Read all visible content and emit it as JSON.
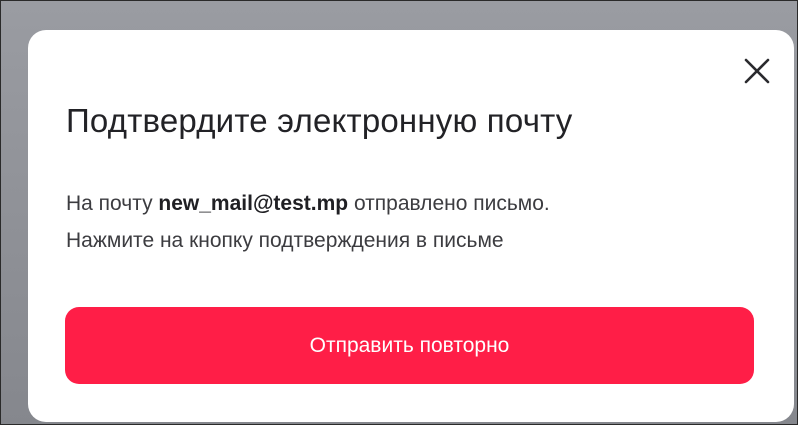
{
  "modal": {
    "title": "Подтвердите электронную почту",
    "description": {
      "prefix": "На почту ",
      "email": "new_mail@test.mp",
      "suffix": " отправлено письмо.",
      "line2": "Нажмите на кнопку подтверждения в письме"
    },
    "resend_button_label": "Отправить повторно",
    "close_icon": "close-icon"
  },
  "colors": {
    "accent": "#ff1e47",
    "title_text": "#222226",
    "body_text": "#3c3c40",
    "backdrop": "#8c8e94"
  }
}
